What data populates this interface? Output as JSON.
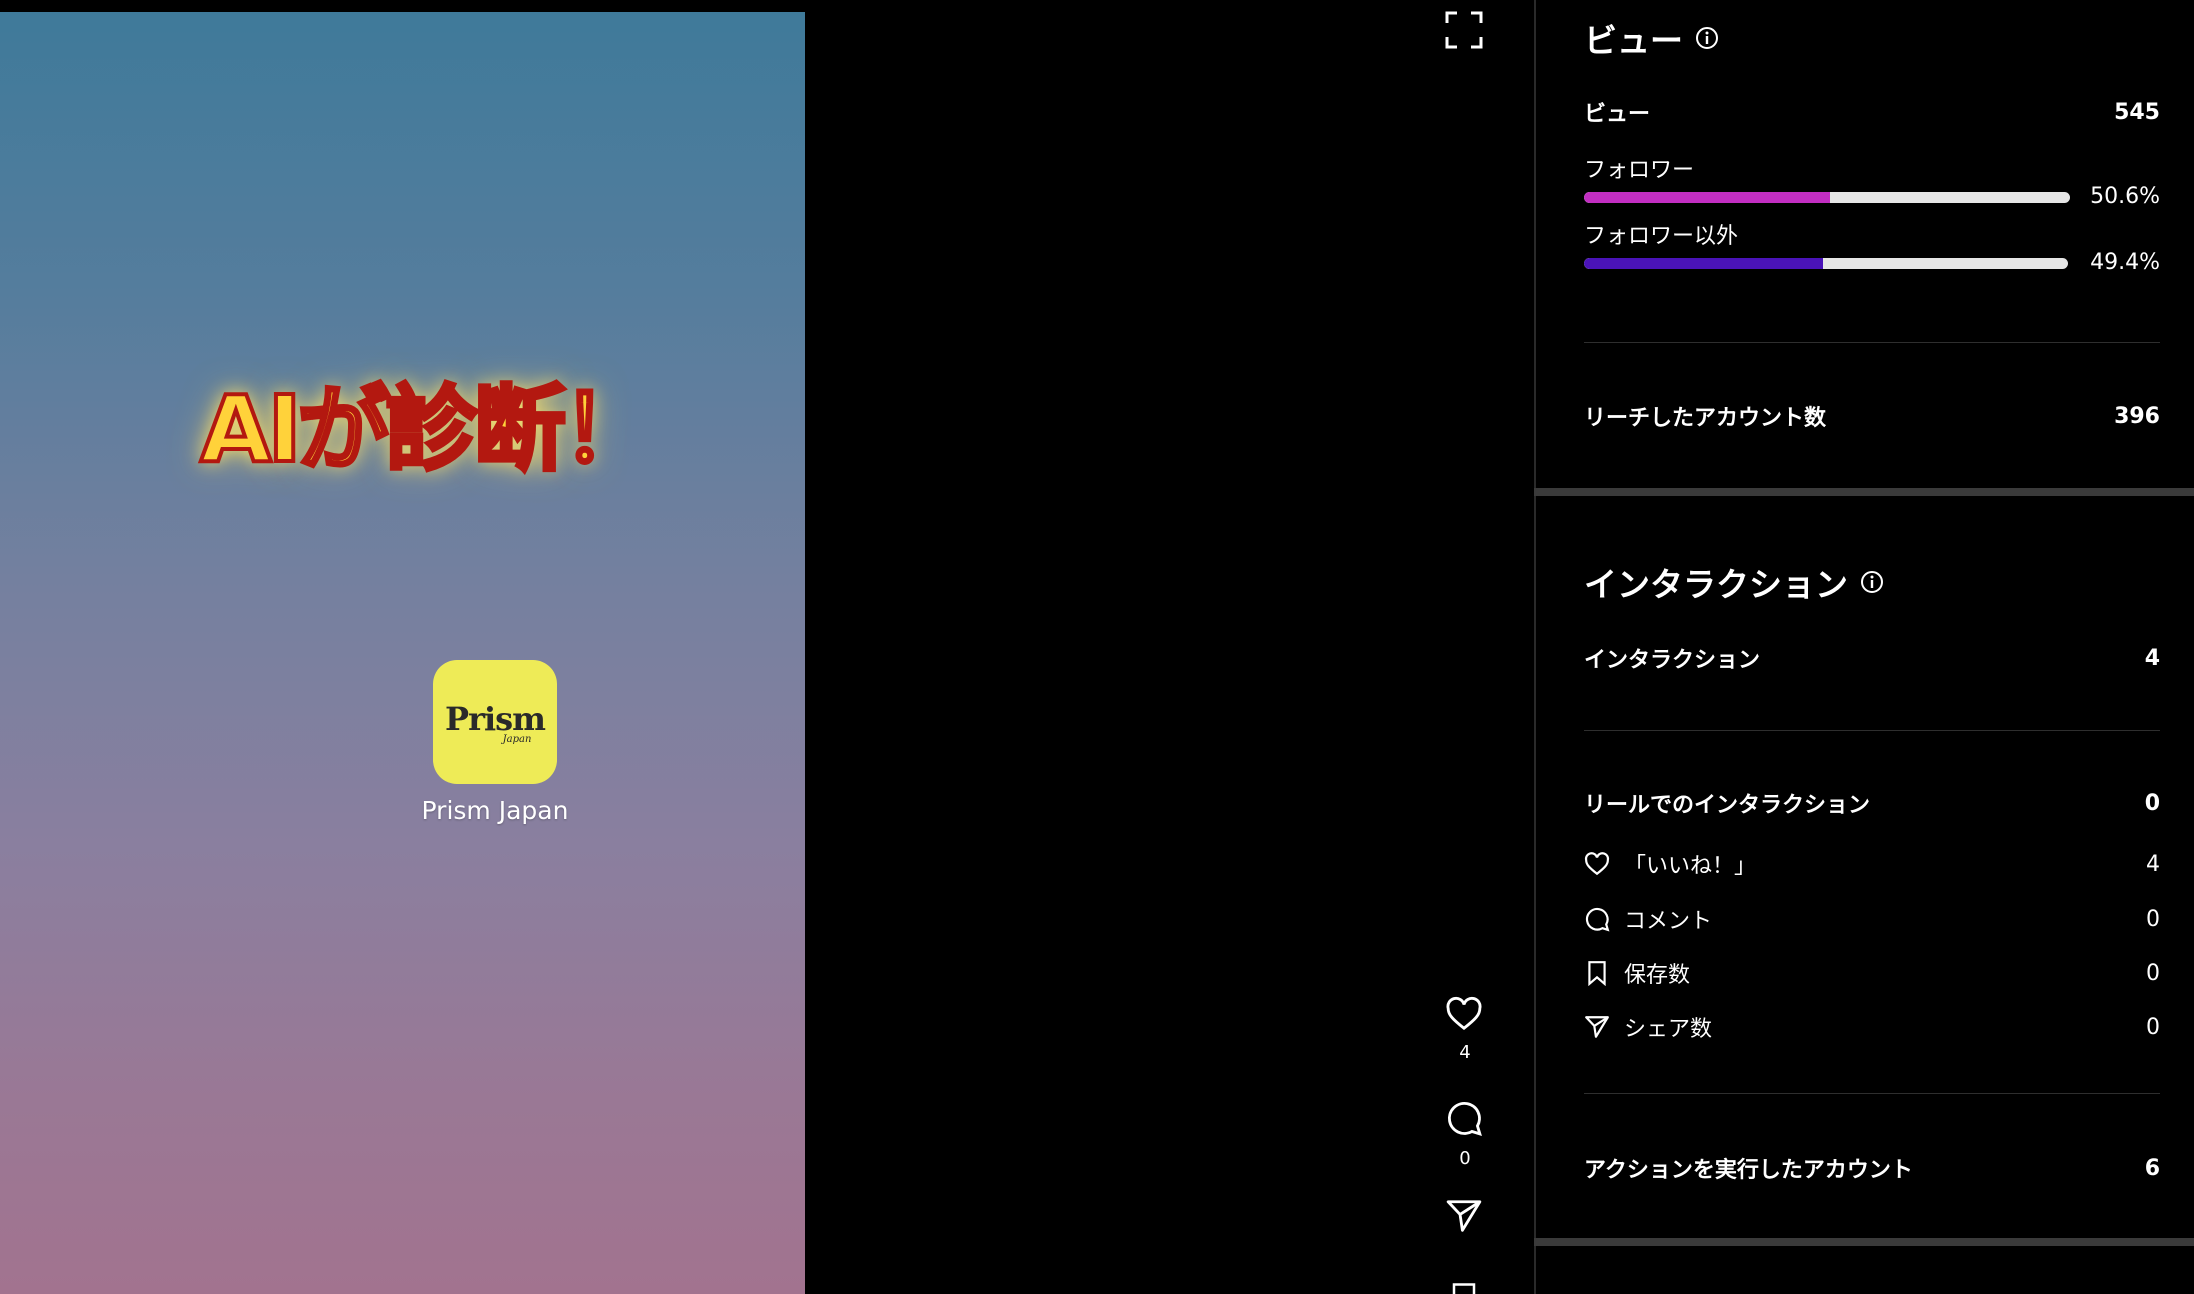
{
  "video": {
    "overlay_text": "AIが診断！",
    "app_label": "Prism Japan",
    "app_logo": "Prism",
    "app_logo_sub": "Japan"
  },
  "actions": {
    "likes_count": "4",
    "comments_count": "0"
  },
  "views_section": {
    "title": "ビュー",
    "total_label": "ビュー",
    "total_value": "545",
    "followers_label": "フォロワー",
    "followers_pct": "50.6%",
    "followers_fraction": 0.506,
    "followers_color": "#c22ec2",
    "nonfollowers_label": "フォロワー以外",
    "nonfollowers_pct": "49.4%",
    "nonfollowers_fraction": 0.494,
    "nonfollowers_color": "#4a13b8",
    "reach_label": "リーチしたアカウント数",
    "reach_value": "396"
  },
  "interactions_section": {
    "title": "インタラクション",
    "total_label": "インタラクション",
    "total_value": "4",
    "reel_label": "リールでのインタラクション",
    "reel_value": "0",
    "likes_label": "「いいね！」",
    "likes_value": "4",
    "comments_label": "コメント",
    "comments_value": "0",
    "saves_label": "保存数",
    "saves_value": "0",
    "shares_label": "シェア数",
    "shares_value": "0",
    "accounts_label": "アクションを実行したアカウント",
    "accounts_value": "6"
  }
}
